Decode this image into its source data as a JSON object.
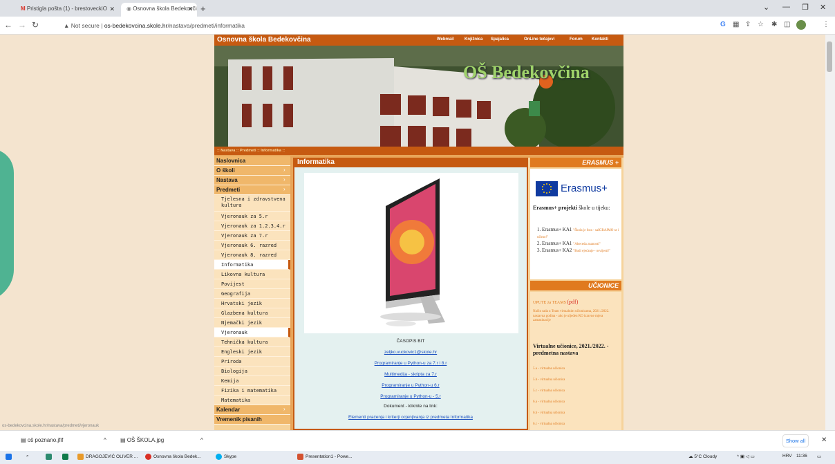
{
  "browser": {
    "tabs": [
      {
        "title": "Pristigla pošta (1) - brestoveckiO",
        "icon": "gmail-icon"
      },
      {
        "title": "Osnovna škola Bedekovčina - Inf",
        "icon": "globe-icon"
      }
    ],
    "url_prefix": "Not secure",
    "url_host": "os-bedekovcina.skole.hr",
    "url_path": "/nastava/predmeti/informatika"
  },
  "site": {
    "name": "Osnovna škola Bedekovčina",
    "banner_title": "OŠ Bedekovčina",
    "top_links": [
      "Webmail",
      "Knjižnica",
      "Spajalica",
      "OnLine tečajevi",
      "Forum",
      "Kontakti"
    ],
    "breadcrumb": ":: Nastava :: Predmeti :: Informatika ::"
  },
  "nav": {
    "items": [
      {
        "label": "Naslovnica",
        "kind": "main",
        "arrow": false
      },
      {
        "label": "O školi",
        "kind": "main",
        "arrow": true
      },
      {
        "label": "Nastava",
        "kind": "main",
        "arrow": true
      },
      {
        "label": "Predmeti",
        "kind": "main",
        "arrow": true
      },
      {
        "label": "Tjelesna i zdravstvena kultura",
        "kind": "sub"
      },
      {
        "label": "Vjeronauk za 5.r",
        "kind": "sub"
      },
      {
        "label": "Vjeronauk za 1.2.3.4.r",
        "kind": "sub"
      },
      {
        "label": "Vjeronauk za 7.r",
        "kind": "sub"
      },
      {
        "label": "Vjeronauk 6. razred",
        "kind": "sub"
      },
      {
        "label": "Vjeronauk 8. razred",
        "kind": "sub"
      },
      {
        "label": "Informatika",
        "kind": "sub",
        "current": true
      },
      {
        "label": "Likovna kultura",
        "kind": "sub"
      },
      {
        "label": "Povijest",
        "kind": "sub"
      },
      {
        "label": "Geografija",
        "kind": "sub"
      },
      {
        "label": "Hrvatski jezik",
        "kind": "sub"
      },
      {
        "label": "Glazbena kultura",
        "kind": "sub"
      },
      {
        "label": "Njemački jezik",
        "kind": "sub"
      },
      {
        "label": "Vjeronauk",
        "kind": "sub",
        "current": true
      },
      {
        "label": "Tehnička kultura",
        "kind": "sub"
      },
      {
        "label": "Engleski jezik",
        "kind": "sub"
      },
      {
        "label": "Priroda",
        "kind": "sub"
      },
      {
        "label": "Biologija",
        "kind": "sub"
      },
      {
        "label": "Kemija",
        "kind": "sub"
      },
      {
        "label": "Fizika i matematika",
        "kind": "sub"
      },
      {
        "label": "Matematika",
        "kind": "sub"
      },
      {
        "label": "Kalendar",
        "kind": "main",
        "arrow": true
      },
      {
        "label": "Vremenik pisanih",
        "kind": "main",
        "arrow": false
      }
    ]
  },
  "main": {
    "title": "Informatika",
    "magazine": "ČASOPIS BIT",
    "email": "zeljko.vuckovic1@skole.hr",
    "links": [
      "Programiranje u Python-u za 7.r i 8.r",
      "Multimedija - skripta za 7.r",
      "Programiranje u Python-u 6.r",
      "Programiranje u Python-u - 5.r"
    ],
    "doc_text": "Dokument - kliknite na link:",
    "doc_link": "Elementi praćenja i kriterji ocjenjivanja iz predmeta Informatika"
  },
  "sidebar": {
    "erasmus_header": "ERASMUS +",
    "erasmus_logo": "Erasmus+",
    "projects_bold": "Erasmus+ projekti",
    "projects_rest": " škole u tijeku:",
    "projects": [
      {
        "name": "Erasmus+ KA1",
        "title": "\"Škola je fora - saIGRAJMO se i učimo!\""
      },
      {
        "name": "Erasmus+ KA1",
        "title": "\"Abeceda znanosti\""
      },
      {
        "name": "Erasmus+ KA2",
        "title": "\"Budi ejećanje - osvijesti!\""
      }
    ],
    "classroom_header": "UČIONICE",
    "teams_link": "UPUTE za TEAMS",
    "teams_pdf": "(pdf)",
    "teams_note": "Način rada u Team virtualnim učionicama, 2021./2022. nastavna godina - ako je uljeđen RO izravne mjera zamasinacije",
    "virtual_title": "Virtualne učionice, 2021./2022. - predmetna nastava",
    "classes": [
      "5.a - virtualna učionica",
      "5.b - virtualna učionica",
      "5.c - virtualna učionica",
      "6.a - virtualna učionica",
      "6.b - virtualna učionica",
      "6.c - virtualna učionica"
    ]
  },
  "status_url": "os-bedekovcina.skole.hr/nastava/predmeti/vjeronauk",
  "downloads": {
    "items": [
      "oš poznano.jfif",
      "OŠ ŠKOLA.jpg"
    ],
    "show_all": "Show all"
  },
  "taskbar": {
    "apps": [
      "DRAGOJEVIĆ OLIVER ...",
      "Osnovna škola Bedek...",
      "Skype",
      "Presentation1 - Powe..."
    ],
    "weather": "5°C Cloudy",
    "lang": "HRV",
    "time": "11:36"
  },
  "colors": {
    "accent": "#c65a11",
    "nav_bg": "#f6d39b",
    "page_bg": "#f4e4cf",
    "link": "#1a4fc0"
  }
}
